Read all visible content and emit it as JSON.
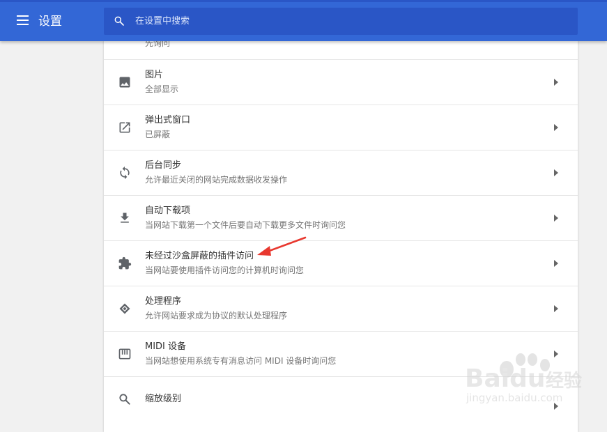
{
  "header": {
    "title": "设置",
    "search_placeholder": "在设置中搜索"
  },
  "partial_row": {
    "subtitle": "先询问"
  },
  "rows": [
    {
      "icon": "image-icon",
      "title": "图片",
      "subtitle": "全部显示"
    },
    {
      "icon": "popup-open-in-new-icon",
      "title": "弹出式窗口",
      "subtitle": "已屏蔽"
    },
    {
      "icon": "sync-icon",
      "title": "后台同步",
      "subtitle": "允许最近关闭的网站完成数据收发操作"
    },
    {
      "icon": "download-icon",
      "title": "自动下载项",
      "subtitle": "当网站下载第一个文件后要自动下载更多文件时询问您"
    },
    {
      "icon": "puzzle-extension-icon",
      "title": "未经过沙盒屏蔽的插件访问",
      "subtitle": "当网站要使用插件访问您的计算机时询问您"
    },
    {
      "icon": "protocol-handler-icon",
      "title": "处理程序",
      "subtitle": "允许网站要求成为协议的默认处理程序"
    },
    {
      "icon": "midi-piano-icon",
      "title": "MIDI 设备",
      "subtitle": "当网站想使用系统专有消息访问 MIDI 设备时询问您"
    },
    {
      "icon": "zoom-search-icon",
      "title": "缩放级别",
      "subtitle": ""
    }
  ],
  "watermark": {
    "brand": "Baidu",
    "cn": "经验",
    "url": "jingyan.baidu.com"
  },
  "colors": {
    "header": "#3367d6",
    "search_bg": "#2a56c6",
    "annotation_arrow": "#e8382f"
  }
}
